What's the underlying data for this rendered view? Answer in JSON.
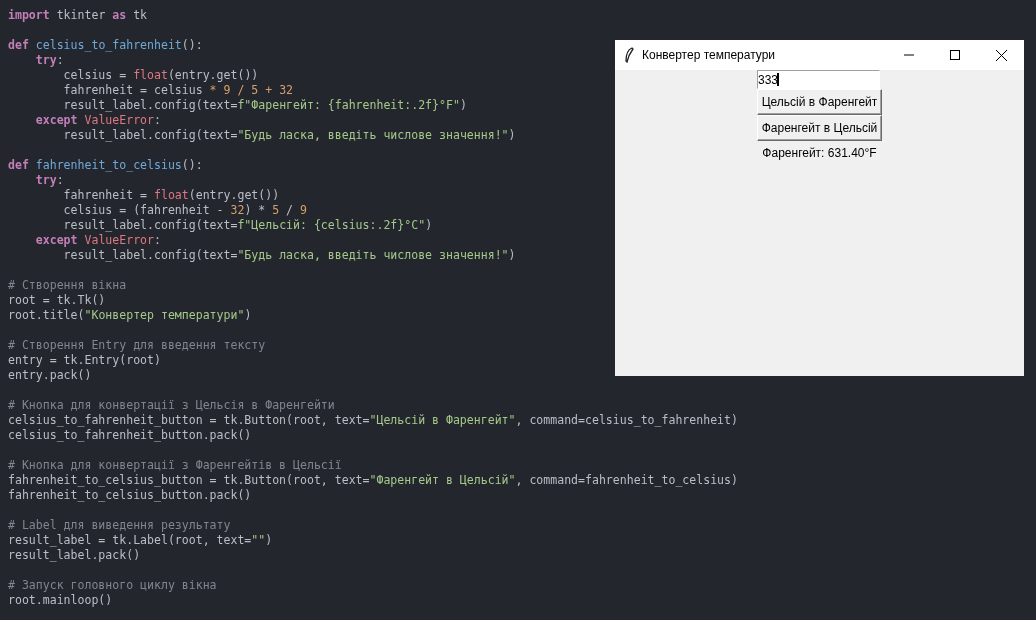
{
  "editor": {
    "blocks": [
      [
        [
          {
            "kind": "keyword",
            "text": "import"
          },
          {
            "kind": "plain",
            "text": " tkinter "
          },
          {
            "kind": "keyword",
            "text": "as"
          },
          {
            "kind": "plain",
            "text": " tk"
          }
        ]
      ],
      [
        [
          {
            "kind": "keyword",
            "text": "def"
          },
          {
            "kind": "function",
            "text": " celsius_to_fahrenheit"
          },
          {
            "kind": "plain",
            "text": "():"
          }
        ],
        [
          {
            "kind": "keyword",
            "text": "    try"
          },
          {
            "kind": "plain",
            "text": ":"
          }
        ],
        [
          {
            "kind": "plain",
            "text": "        celsius = "
          },
          {
            "kind": "builtin",
            "text": "float"
          },
          {
            "kind": "plain",
            "text": "(entry.get())"
          }
        ],
        [
          {
            "kind": "plain",
            "text": "        fahrenheit = celsius "
          },
          {
            "kind": "number",
            "text": "* 9 / 5 + 32"
          }
        ],
        [
          {
            "kind": "plain",
            "text": "        result_label.config(text="
          },
          {
            "kind": "string",
            "text": "f\"Фаренгейт: {fahrenheit:.2f}°F\""
          },
          {
            "kind": "plain",
            "text": ")"
          }
        ],
        [
          {
            "kind": "keyword",
            "text": "    except"
          },
          {
            "kind": "builtin",
            "text": " ValueError"
          },
          {
            "kind": "plain",
            "text": ":"
          }
        ],
        [
          {
            "kind": "plain",
            "text": "        result_label.config(text="
          },
          {
            "kind": "string",
            "text": "\"Будь ласка, введіть числове значення!\""
          },
          {
            "kind": "plain",
            "text": ")"
          }
        ]
      ],
      [
        [
          {
            "kind": "keyword",
            "text": "def"
          },
          {
            "kind": "function",
            "text": " fahrenheit_to_celsius"
          },
          {
            "kind": "plain",
            "text": "():"
          }
        ],
        [
          {
            "kind": "keyword",
            "text": "    try"
          },
          {
            "kind": "plain",
            "text": ":"
          }
        ],
        [
          {
            "kind": "plain",
            "text": "        fahrenheit = "
          },
          {
            "kind": "builtin",
            "text": "float"
          },
          {
            "kind": "plain",
            "text": "(entry.get())"
          }
        ],
        [
          {
            "kind": "plain",
            "text": "        celsius = (fahrenheit - "
          },
          {
            "kind": "number",
            "text": "32"
          },
          {
            "kind": "plain",
            "text": ") * "
          },
          {
            "kind": "number",
            "text": "5"
          },
          {
            "kind": "plain",
            "text": " / "
          },
          {
            "kind": "number",
            "text": "9"
          }
        ],
        [
          {
            "kind": "plain",
            "text": "        result_label.config(text="
          },
          {
            "kind": "string",
            "text": "f\"Цельсій: {celsius:.2f}°C\""
          },
          {
            "kind": "plain",
            "text": ")"
          }
        ],
        [
          {
            "kind": "keyword",
            "text": "    except"
          },
          {
            "kind": "builtin",
            "text": " ValueError"
          },
          {
            "kind": "plain",
            "text": ":"
          }
        ],
        [
          {
            "kind": "plain",
            "text": "        result_label.config(text="
          },
          {
            "kind": "string",
            "text": "\"Будь ласка, введіть числове значення!\""
          },
          {
            "kind": "plain",
            "text": ")"
          }
        ]
      ],
      [
        [
          {
            "kind": "comment",
            "text": "# Створення вікна"
          }
        ],
        [
          {
            "kind": "plain",
            "text": "root = tk.Tk()"
          }
        ],
        [
          {
            "kind": "plain",
            "text": "root.title("
          },
          {
            "kind": "string",
            "text": "\"Конвертер температури\""
          },
          {
            "kind": "plain",
            "text": ")"
          }
        ]
      ],
      [
        [
          {
            "kind": "comment",
            "text": "# Створення Entry для введення тексту"
          }
        ],
        [
          {
            "kind": "plain",
            "text": "entry = tk.Entry(root)"
          }
        ],
        [
          {
            "kind": "plain",
            "text": "entry.pack()"
          }
        ]
      ],
      [
        [
          {
            "kind": "comment",
            "text": "# Кнопка для конвертації з Цельсія в Фаренгейти"
          }
        ],
        [
          {
            "kind": "plain",
            "text": "celsius_to_fahrenheit_button = tk.Button(root, text="
          },
          {
            "kind": "string",
            "text": "\"Цельсій в Фаренгейт\""
          },
          {
            "kind": "plain",
            "text": ", command=celsius_to_fahrenheit)"
          }
        ],
        [
          {
            "kind": "plain",
            "text": "celsius_to_fahrenheit_button.pack()"
          }
        ]
      ],
      [
        [
          {
            "kind": "comment",
            "text": "# Кнопка для конвертації з Фаренгейтів в Цельсії"
          }
        ],
        [
          {
            "kind": "plain",
            "text": "fahrenheit_to_celsius_button = tk.Button(root, text="
          },
          {
            "kind": "string",
            "text": "\"Фаренгейт в Цельсій\""
          },
          {
            "kind": "plain",
            "text": ", command=fahrenheit_to_celsius)"
          }
        ],
        [
          {
            "kind": "plain",
            "text": "fahrenheit_to_celsius_button.pack()"
          }
        ]
      ],
      [
        [
          {
            "kind": "comment",
            "text": "# Label для виведення результату"
          }
        ],
        [
          {
            "kind": "plain",
            "text": "result_label = tk.Label(root, text="
          },
          {
            "kind": "string",
            "text": "\"\""
          },
          {
            "kind": "plain",
            "text": ")"
          }
        ],
        [
          {
            "kind": "plain",
            "text": "result_label.pack()"
          }
        ]
      ],
      [
        [
          {
            "kind": "comment",
            "text": "# Запуск головного циклу вікна"
          }
        ],
        [
          {
            "kind": "plain",
            "text": "root.mainloop()"
          }
        ]
      ]
    ]
  },
  "app_window": {
    "title": "Конвертер температури",
    "entry": {
      "value": "333"
    },
    "buttons": [
      "Цельсій в Фаренгейт",
      "Фаренгейт в Цельсій"
    ],
    "result": "Фаренгейт: 631.40°F"
  }
}
